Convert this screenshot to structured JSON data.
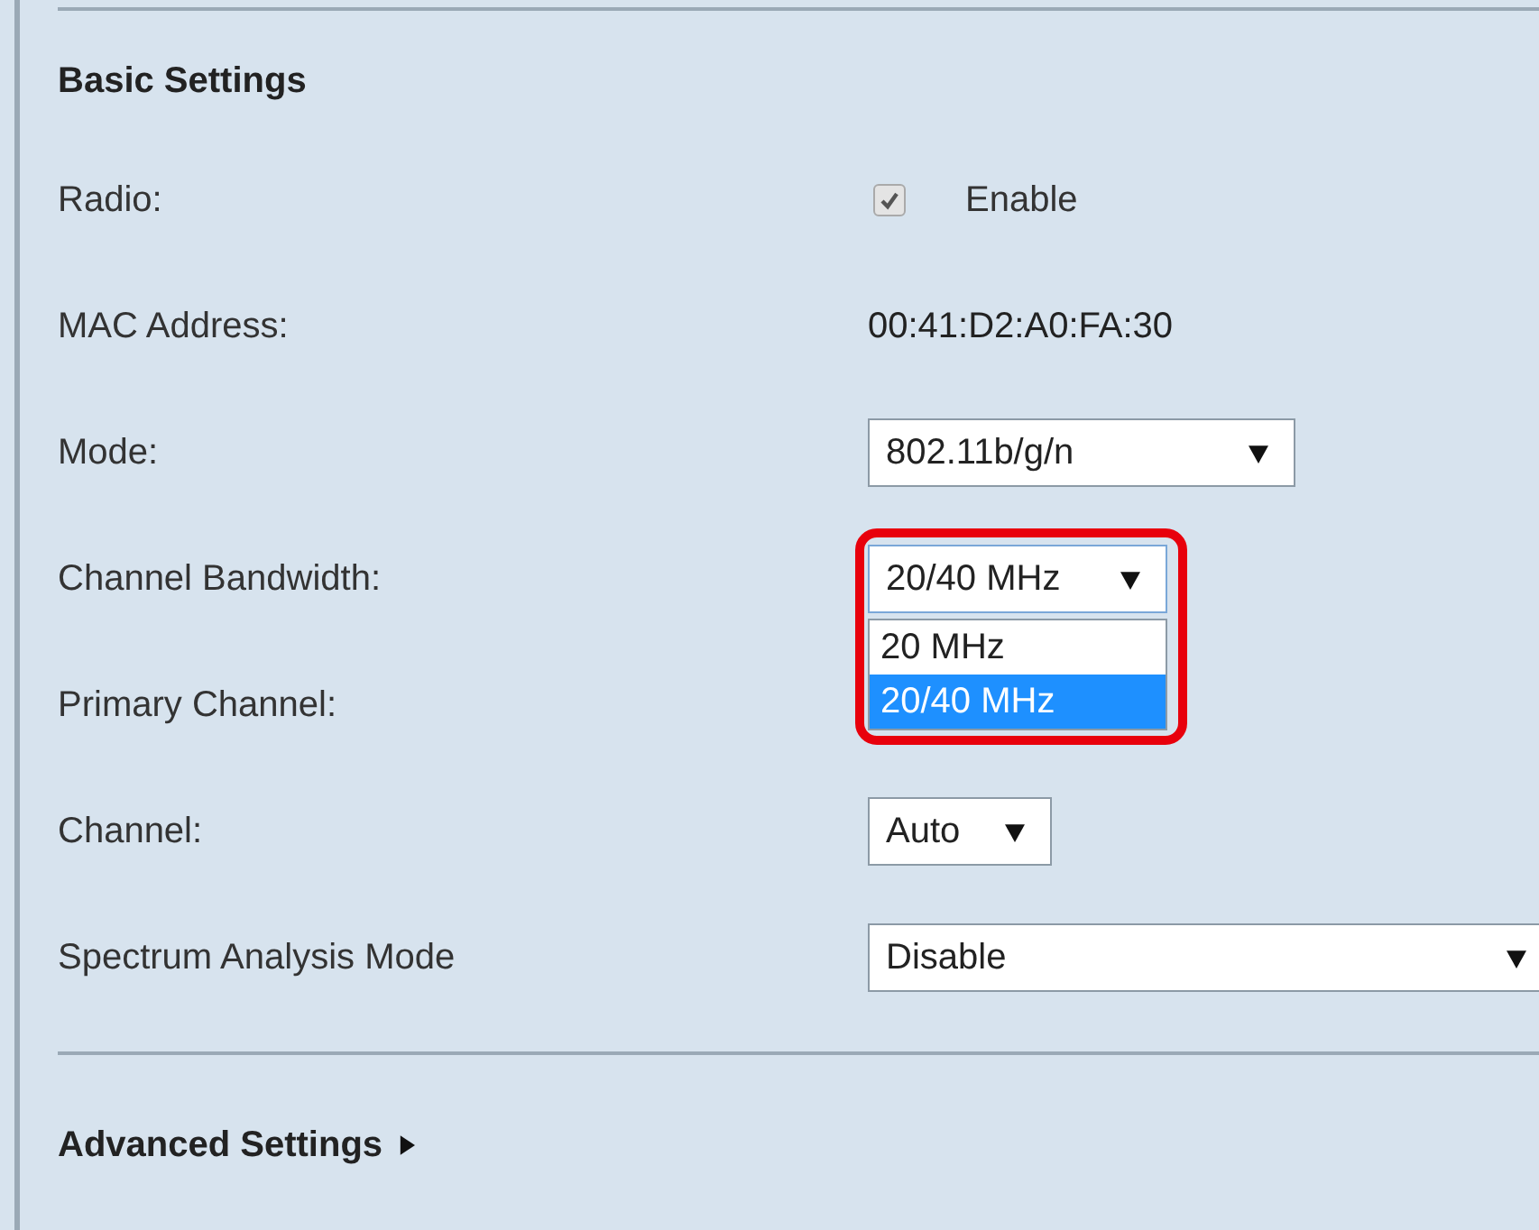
{
  "heading": "Basic Settings",
  "rows": [
    {
      "label": "Radio:",
      "kind": "checkbox",
      "checked": true,
      "disabled": true,
      "text": "Enable"
    },
    {
      "label": "MAC Address:",
      "kind": "text",
      "text": "00:41:D2:A0:FA:30"
    },
    {
      "label": "Mode:",
      "kind": "select",
      "value": "802.11b/g/n"
    },
    {
      "label": "Channel Bandwidth:",
      "kind": "select",
      "value": "20/40 MHz",
      "highlighted": true,
      "expanded": true,
      "options": [
        {
          "label": "20 MHz",
          "selected": false
        },
        {
          "label": "20/40 MHz",
          "selected": true
        }
      ]
    },
    {
      "label": "Primary Channel:",
      "kind": "none"
    },
    {
      "label": "Channel:",
      "kind": "select",
      "value": "Auto"
    },
    {
      "label": "Spectrum Analysis Mode",
      "kind": "select",
      "value": "Disable"
    }
  ],
  "advanced": {
    "label": "Advanced Settings",
    "expanded": false
  }
}
